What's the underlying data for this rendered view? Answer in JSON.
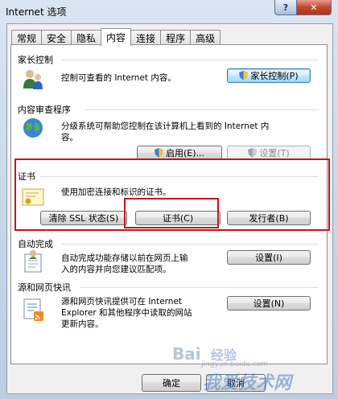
{
  "window": {
    "title": "Internet 选项",
    "help_glyph": "?",
    "close_glyph": "✕"
  },
  "tabs": [
    {
      "label": "常规",
      "active": false
    },
    {
      "label": "安全",
      "active": false
    },
    {
      "label": "隐私",
      "active": false
    },
    {
      "label": "内容",
      "active": true
    },
    {
      "label": "连接",
      "active": false
    },
    {
      "label": "程序",
      "active": false
    },
    {
      "label": "高级",
      "active": false
    }
  ],
  "parental": {
    "title": "家长控制",
    "desc": "控制可查看的 Internet 内容。",
    "button": "家长控制(P)"
  },
  "advisor": {
    "title": "内容审查程序",
    "desc_line1": "分级系统可帮助您控制在该计算机上看到的 Internet 内",
    "desc_line2": "容。",
    "enable_button": "启用(E)...",
    "settings_button": "设置(T)"
  },
  "certificates": {
    "title": "证书",
    "desc": "使用加密连接和标识的证书。",
    "clear_ssl_button": "清除 SSL 状态(S)",
    "certificates_button": "证书(C)",
    "publishers_button": "发行者(B)"
  },
  "autocomplete": {
    "title": "自动完成",
    "desc_line1": "自动完成功能存储以前在网页上输",
    "desc_line2": "入的内容并向您建议匹配项。",
    "button": "设置(I)"
  },
  "feeds": {
    "title": "源和网页快讯",
    "desc_line1": "源和网页快讯提供可在 Internet",
    "desc_line2": "Explorer 和其他程序中读取的网站",
    "desc_line3": "更新内容。",
    "button": "设置(N)"
  },
  "footer": {
    "ok_button": "确定",
    "cancel_button": "取消"
  },
  "watermark": {
    "brand": "Bai",
    "brand_cn": "经验",
    "site": "jingyan.baidu.com",
    "overlay": "我爱技术网"
  }
}
